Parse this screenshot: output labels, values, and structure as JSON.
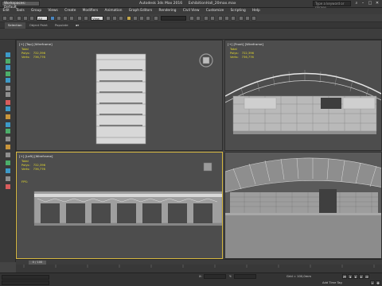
{
  "titlebar": {
    "workspace": "Workspaces: Default",
    "app_name": "Autodesk 3ds Max 2016",
    "file_name": "ExhibitionHall_20max.max",
    "search_placeholder": "Type a keyword or phrase"
  },
  "menu": [
    "Edit",
    "Tools",
    "Group",
    "Views",
    "Create",
    "Modifiers",
    "Animation",
    "Graph Editors",
    "Rendering",
    "Civil View",
    "Customize",
    "Scripting",
    "Help"
  ],
  "toolbar": {
    "filter_value": "All",
    "view_value": "View"
  },
  "ribbon": {
    "tabs": [
      "Selection",
      "Object Paint",
      "Populate"
    ]
  },
  "viewports": {
    "top": {
      "label": "[+] [Top] [Wireframe]",
      "stats": {
        "total_label": "Total",
        "polys_label": "Polys:",
        "polys_value": "722,396",
        "verts_label": "Verts:",
        "verts_value": "736,776"
      }
    },
    "front": {
      "label": "[+] [Front] [Wireframe]",
      "stats": {
        "total_label": "Total",
        "polys_label": "Polys:",
        "polys_value": "722,396",
        "verts_label": "Verts:",
        "verts_value": "736,776"
      }
    },
    "left": {
      "label": "[+] [Left] [Wireframe]",
      "stats": {
        "total_label": "Total",
        "polys_label": "Polys:",
        "polys_value": "722,396",
        "verts_label": "Verts:",
        "verts_value": "736,776"
      },
      "fps": "FPS:"
    },
    "persp": {
      "label": ""
    }
  },
  "timeline": {
    "frame_display": "0 / 100"
  },
  "statusbar": {
    "x_label": "X:",
    "y_label": "Y:",
    "grid": "Grid = 100,0mm",
    "add_time_tag": "Add Time Tag"
  }
}
